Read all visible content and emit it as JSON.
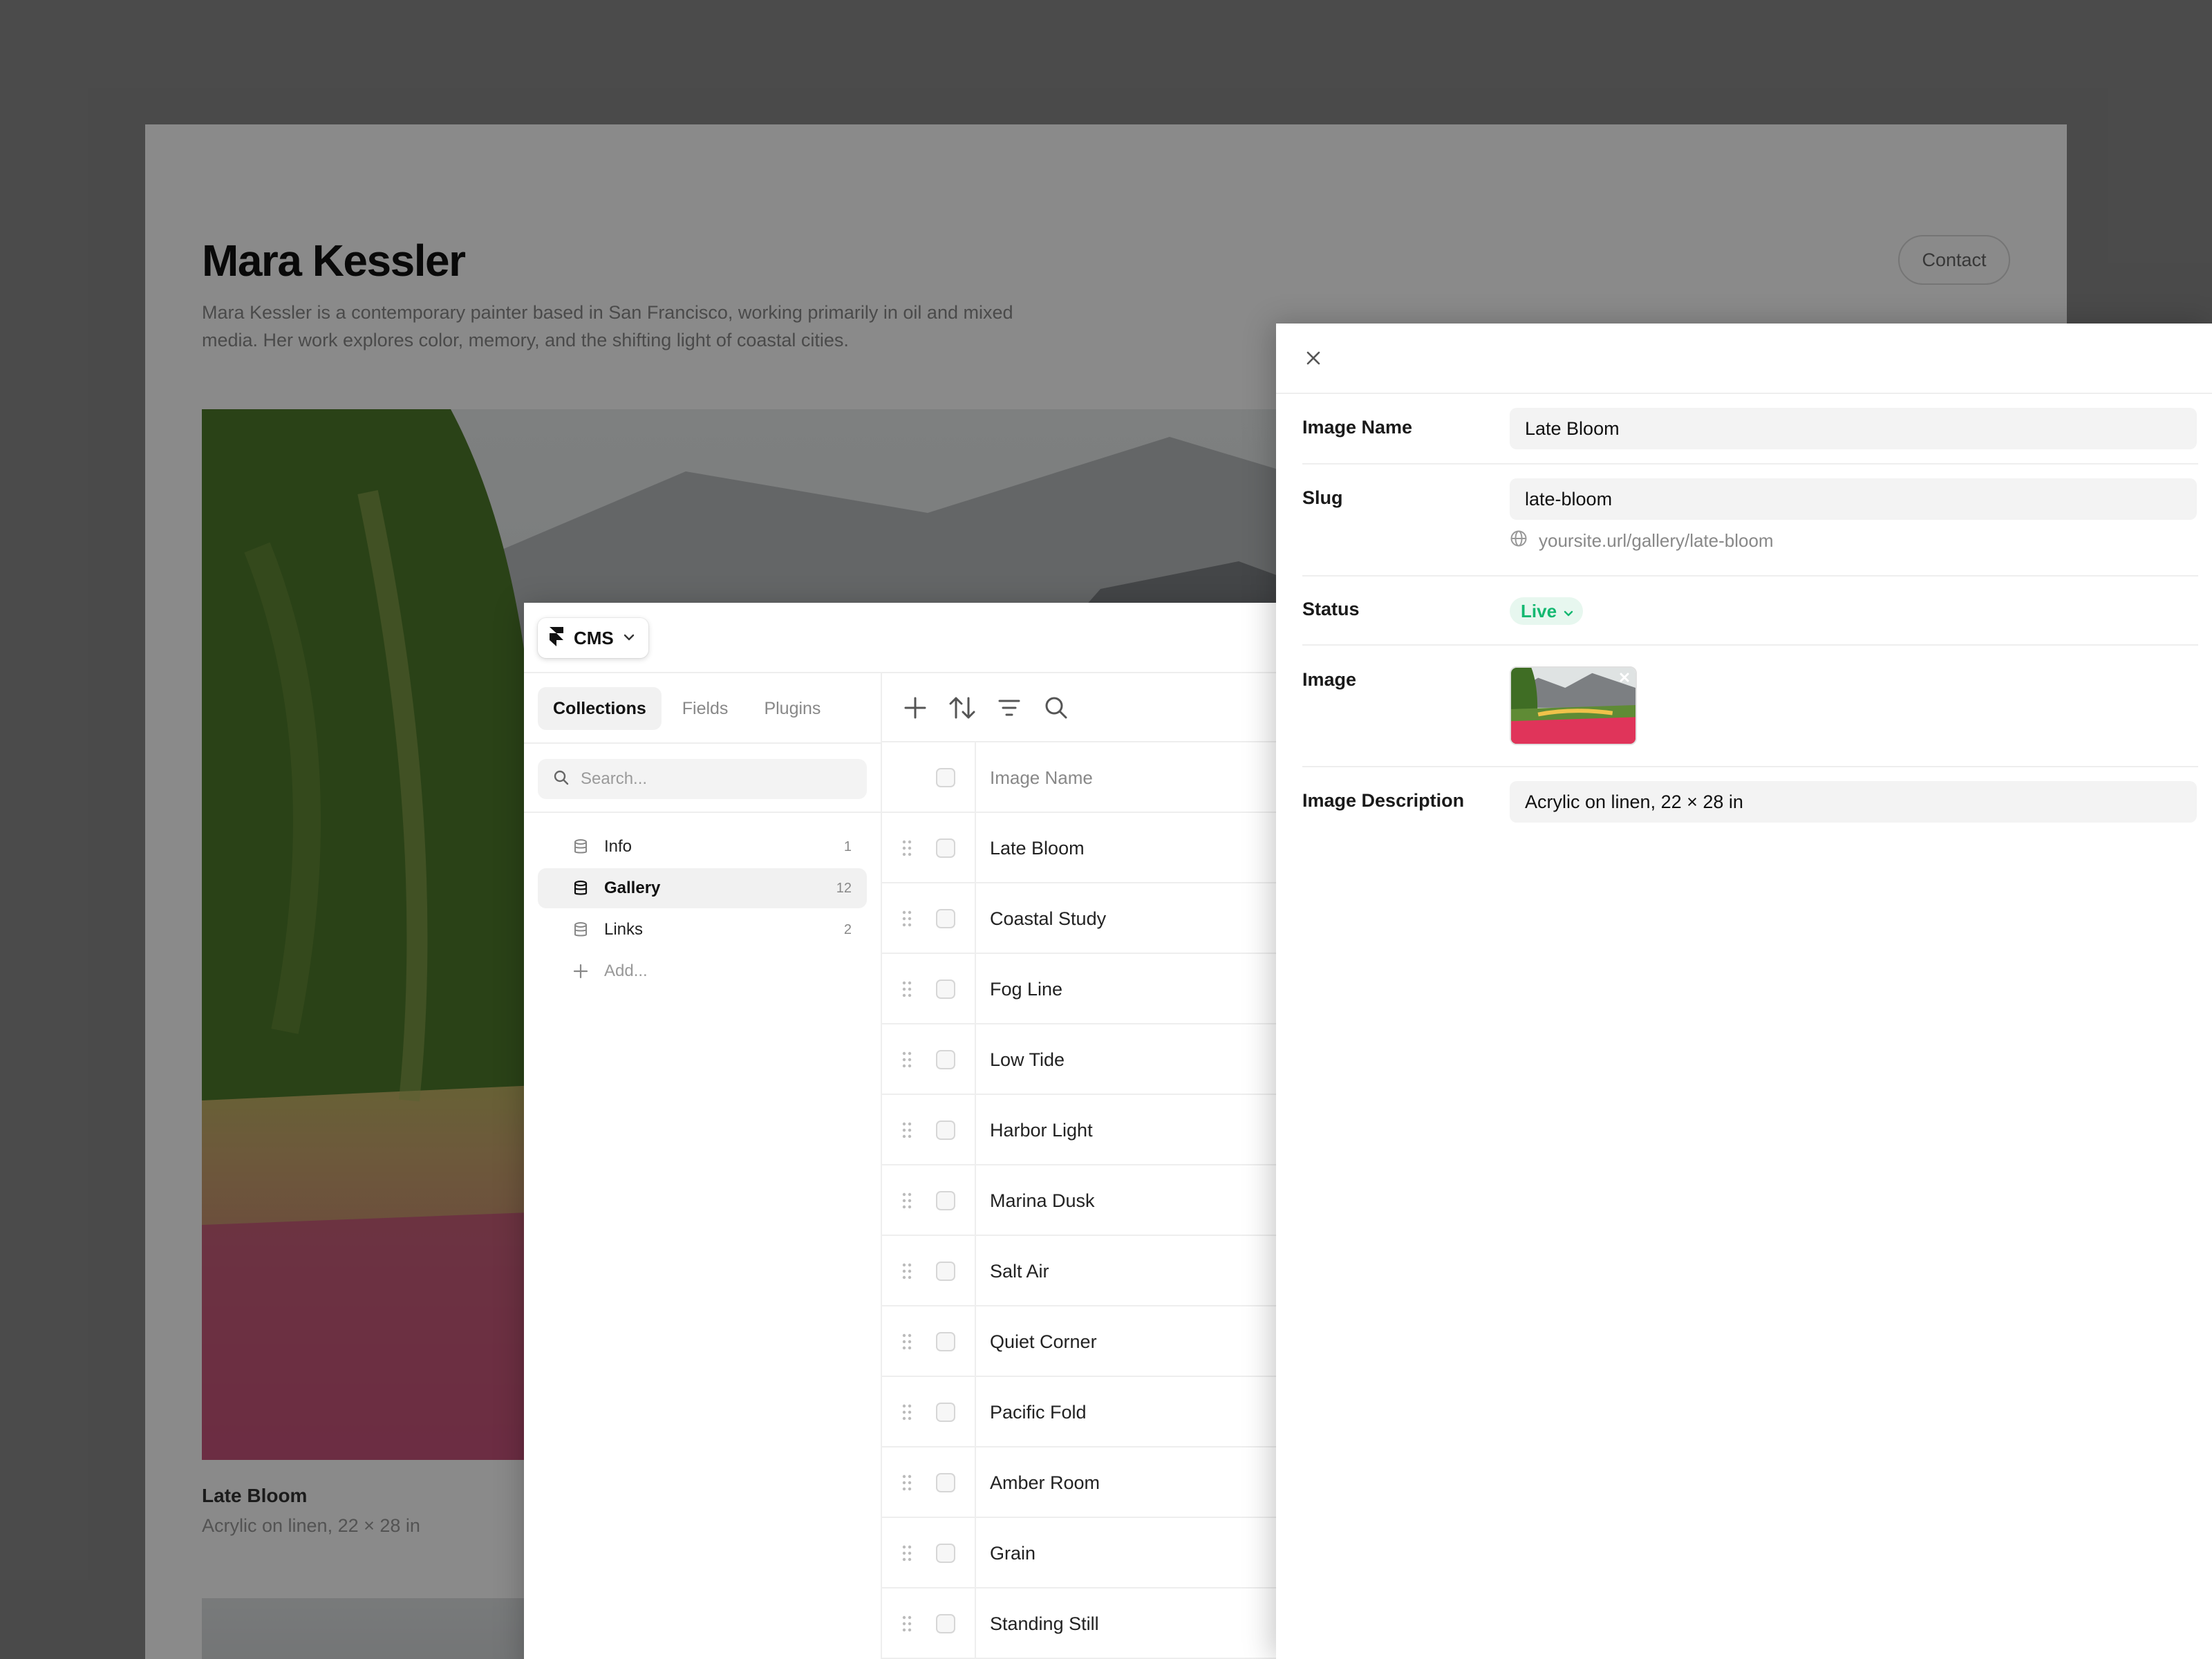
{
  "site": {
    "artist_name": "Mara Kessler",
    "bio": "Mara Kessler is a contemporary painter based in San Francisco, working primarily in oil and mixed media. Her work explores color, memory, and the shifting light of coastal cities.",
    "contact_label": "Contact",
    "featured": {
      "title": "Late Bloom",
      "description": "Acrylic on linen, 22 × 28 in"
    }
  },
  "cms": {
    "menu_label": "CMS",
    "tabs": [
      {
        "label": "Collections",
        "active": true
      },
      {
        "label": "Fields",
        "active": false
      },
      {
        "label": "Plugins",
        "active": false
      }
    ],
    "search_placeholder": "Search...",
    "collections": [
      {
        "name": "Info",
        "count": "1",
        "active": false
      },
      {
        "name": "Gallery",
        "count": "12",
        "active": true
      },
      {
        "name": "Links",
        "count": "2",
        "active": false
      }
    ],
    "add_label": "Add...",
    "table": {
      "column_header": "Image Name",
      "rows": [
        "Late Bloom",
        "Coastal Study",
        "Fog Line",
        "Low Tide",
        "Harbor Light",
        "Marina Dusk",
        "Salt Air",
        "Quiet Corner",
        "Pacific Fold",
        "Amber Room",
        "Grain",
        "Standing Still"
      ]
    }
  },
  "detail": {
    "fields": {
      "image_name": {
        "label": "Image Name",
        "value": "Late Bloom"
      },
      "slug": {
        "label": "Slug",
        "value": "late-bloom",
        "url": "yoursite.url/gallery/late-bloom"
      },
      "status": {
        "label": "Status",
        "value": "Live"
      },
      "image": {
        "label": "Image"
      },
      "image_description": {
        "label": "Image Description",
        "value": "Acrylic on linen, 22 × 28 in"
      }
    }
  },
  "colors": {
    "status_live": "#14b871",
    "status_live_bg": "#e7f7ef",
    "overlay": "rgba(0,0,0,0.46)"
  },
  "icons": {
    "menu_logo": "framer-logo-icon",
    "database": "database-icon",
    "add": "plus-icon",
    "sort": "sort-arrows-icon",
    "filter": "filter-icon",
    "search": "search-icon",
    "drag": "drag-handle-icon",
    "close": "close-icon",
    "globe": "globe-icon",
    "chevron": "chevron-down-icon"
  }
}
